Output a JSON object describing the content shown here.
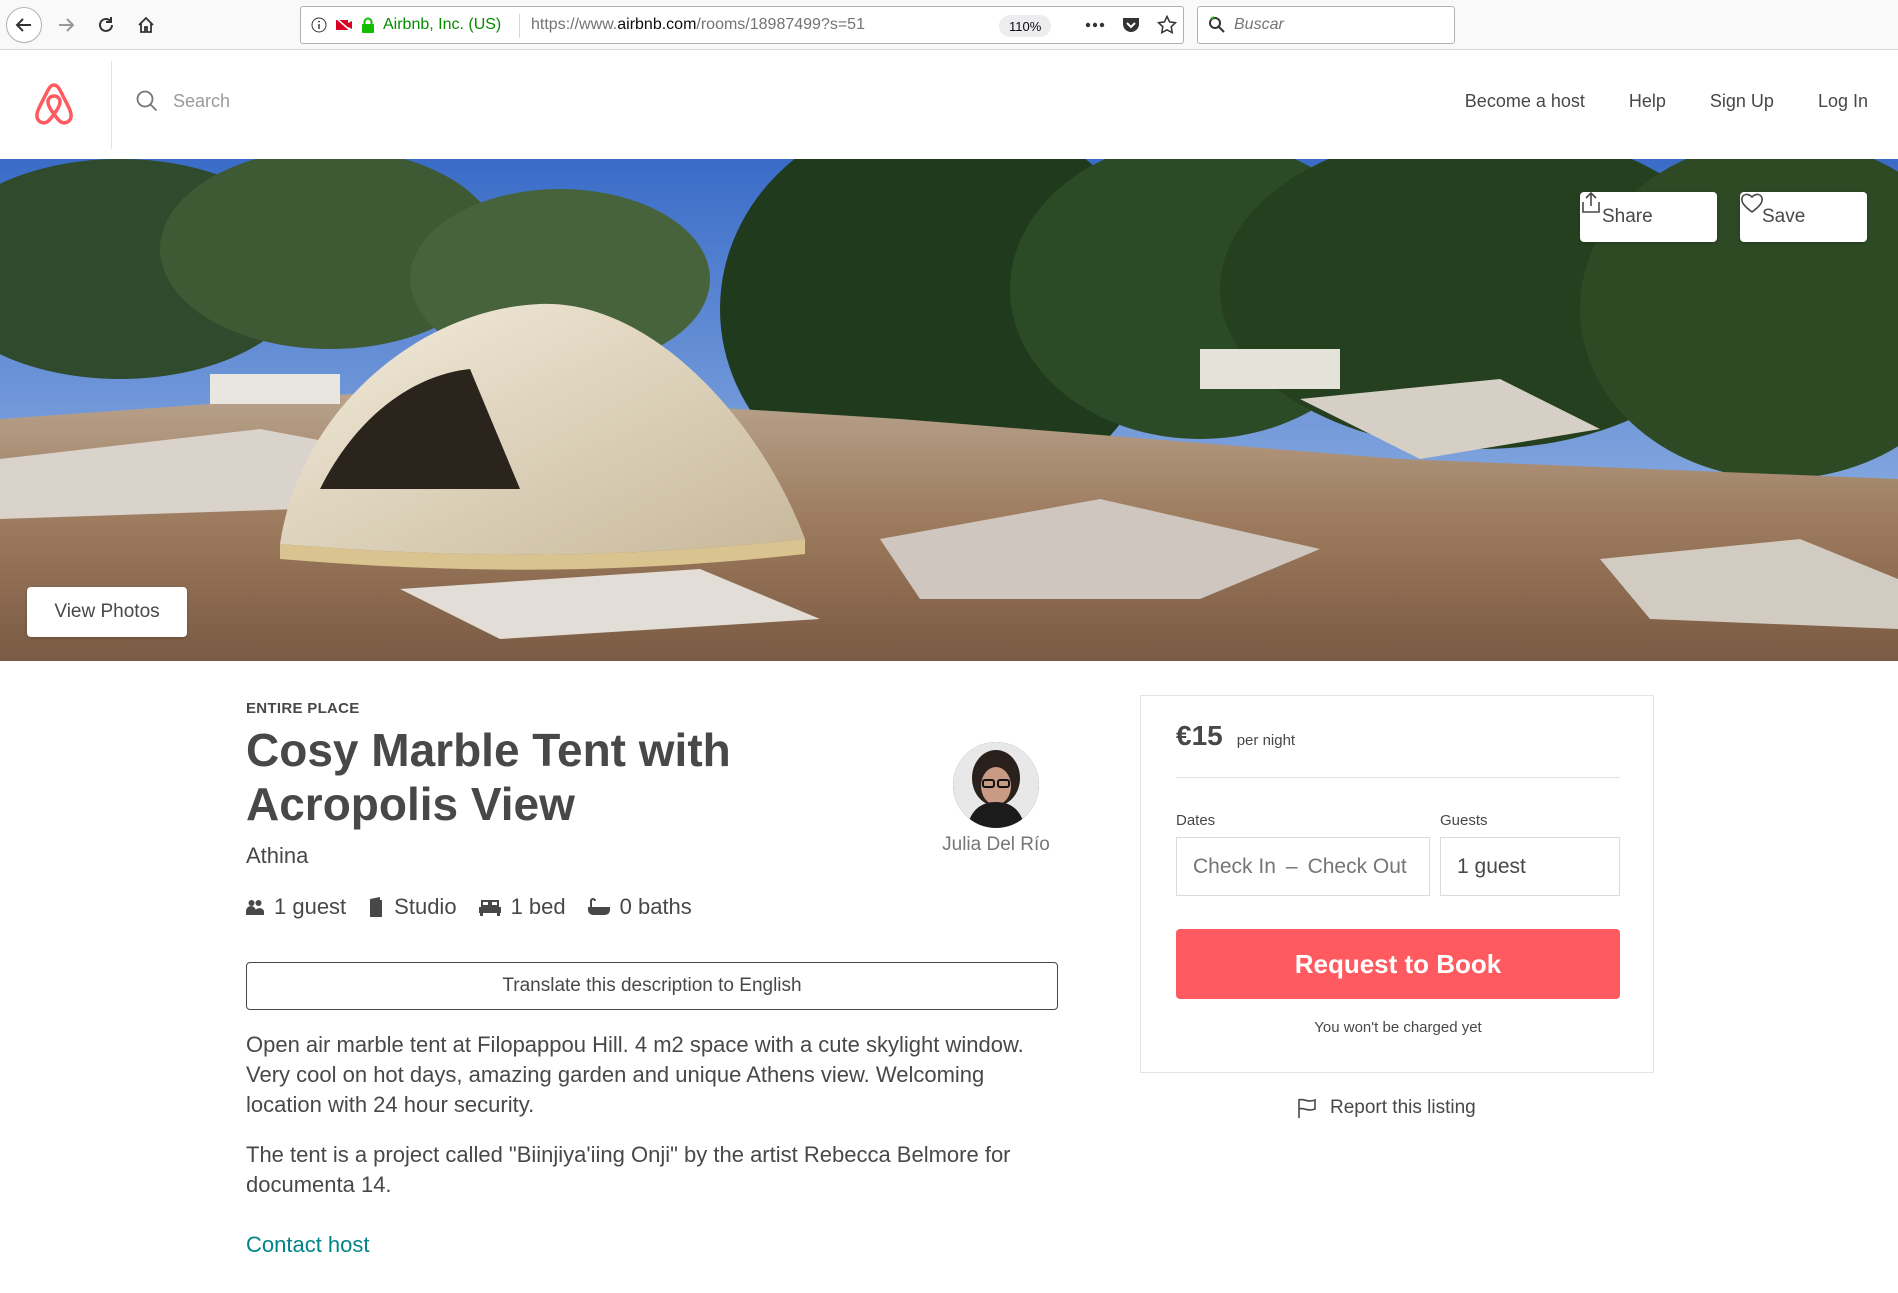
{
  "browser": {
    "site_identity": "Airbnb, Inc. (US)",
    "url_prefix": "https://www.",
    "url_domain": "airbnb.com",
    "url_path": "/rooms/18987499?s=51",
    "zoom": "110%",
    "search_placeholder": "Buscar"
  },
  "header": {
    "search_placeholder": "Search",
    "nav": {
      "become_host": "Become a host",
      "help": "Help",
      "sign_up": "Sign Up",
      "log_in": "Log In"
    },
    "brand_color": "#ff5a5f"
  },
  "hero": {
    "share_label": "Share",
    "save_label": "Save",
    "view_photos_label": "View Photos"
  },
  "listing": {
    "room_type": "ENTIRE PLACE",
    "title": "Cosy Marble Tent with Acropolis View",
    "city": "Athina",
    "host_name": "Julia Del Río",
    "amenities": {
      "guests": "1 guest",
      "room": "Studio",
      "beds": "1 bed",
      "baths": "0 baths"
    },
    "translate_label": "Translate this description to English",
    "description_1": "Open air marble tent at Filopappou Hill. 4 m2 space with a cute skylight window. Very cool on hot days, amazing garden and unique Athens view. Welcoming location with 24 hour security.",
    "description_2": "The tent is a project called \"Biinjiya'iing Onji\" by the artist Rebecca Belmore for documenta 14.",
    "contact_host": "Contact host"
  },
  "booking": {
    "price": "€15",
    "per_night": "per night",
    "dates_label": "Dates",
    "guests_label": "Guests",
    "check_in": "Check In",
    "dash": "–",
    "check_out": "Check Out",
    "guests_value": "1 guest",
    "request_label": "Request to Book",
    "charge_note": "You won't be charged yet",
    "report_label": "Report this listing",
    "button_color": "#ff5a5f"
  }
}
